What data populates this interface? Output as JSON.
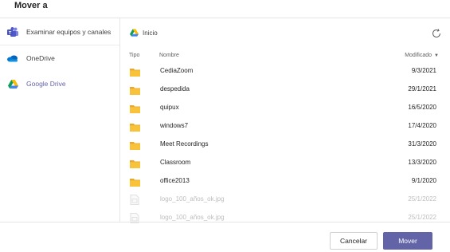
{
  "dialog": {
    "title": "Mover a"
  },
  "sidebar": {
    "items": [
      {
        "label": "Examinar equipos y canales",
        "icon": "teams-icon"
      },
      {
        "label": "OneDrive",
        "icon": "onedrive-icon"
      },
      {
        "label": "Google Drive",
        "icon": "google-drive-icon"
      }
    ]
  },
  "main": {
    "breadcrumb": "Inicio",
    "columns": {
      "tipo": "Tipo",
      "nombre": "Nombre",
      "modificado": "Modificado"
    },
    "rows": [
      {
        "type": "folder",
        "name": "CediaZoom",
        "modified": "9/3/2021"
      },
      {
        "type": "folder",
        "name": "despedida",
        "modified": "29/1/2021"
      },
      {
        "type": "folder",
        "name": "quipux",
        "modified": "16/5/2020"
      },
      {
        "type": "folder",
        "name": "windows7",
        "modified": "17/4/2020"
      },
      {
        "type": "folder",
        "name": "Meet Recordings",
        "modified": "31/3/2020"
      },
      {
        "type": "folder",
        "name": "Classroom",
        "modified": "13/3/2020"
      },
      {
        "type": "folder",
        "name": "office2013",
        "modified": "9/1/2020"
      },
      {
        "type": "file",
        "name": "logo_100_años_ok.jpg",
        "modified": "25/1/2022"
      },
      {
        "type": "file",
        "name": "logo_100_años_ok.jpg",
        "modified": "25/1/2022"
      }
    ]
  },
  "footer": {
    "cancel_label": "Cancelar",
    "move_label": "Mover"
  },
  "colors": {
    "accent": "#6264a7",
    "folder": "#f8c33a",
    "disabled_text": "#bdbdbd"
  }
}
